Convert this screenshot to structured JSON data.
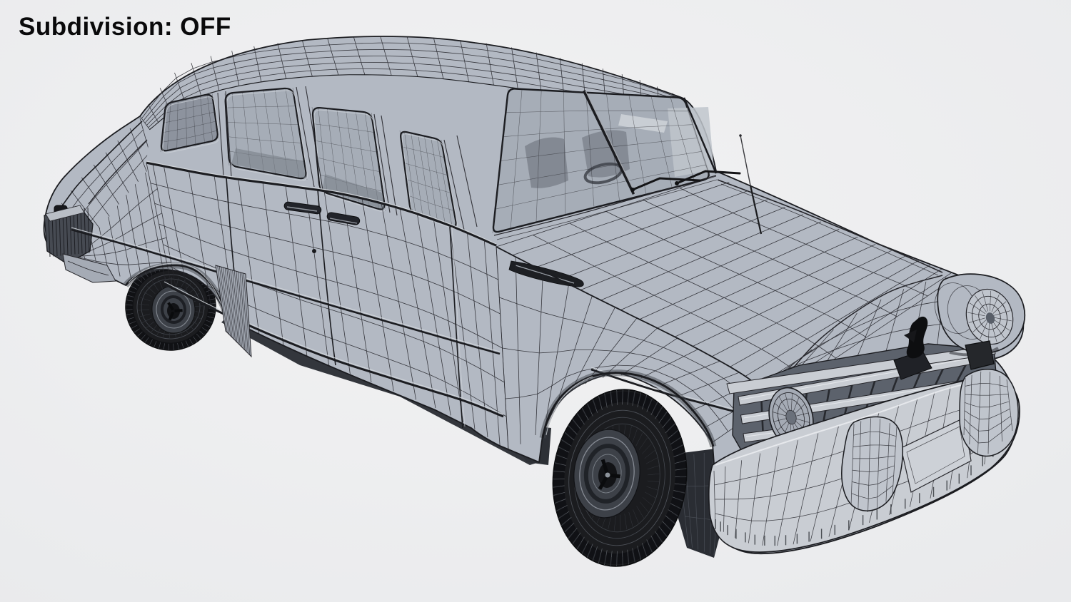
{
  "hud": {
    "label": "Subdivision: OFF"
  },
  "scene": {
    "subject": "vintage-sedan-wireframe-model",
    "view": "front-three-quarter",
    "subdivision_state": "OFF",
    "colors": {
      "bg": "#f2f2f3",
      "bgEdge": "#e9eaec",
      "body": "#b3b9c3",
      "bodyLight": "#c0c5cd",
      "bodyShade": "#a5abb5",
      "bodyDark": "#8f96a1",
      "glass": "#a6adb7",
      "glassDark": "#7a8089",
      "glassLight": "#c6cad1",
      "wire": "#26262b",
      "outline": "#1b1c20",
      "chrome": "#c9cdd3",
      "cavity": "#5c626c",
      "dark": "#141518",
      "tire": "#1b1c1f",
      "tireRing": "#53575e",
      "hub": "#3d4148",
      "hubDark": "#121316",
      "hubLight": "#8e949c",
      "text": "#0a0a0b"
    }
  }
}
